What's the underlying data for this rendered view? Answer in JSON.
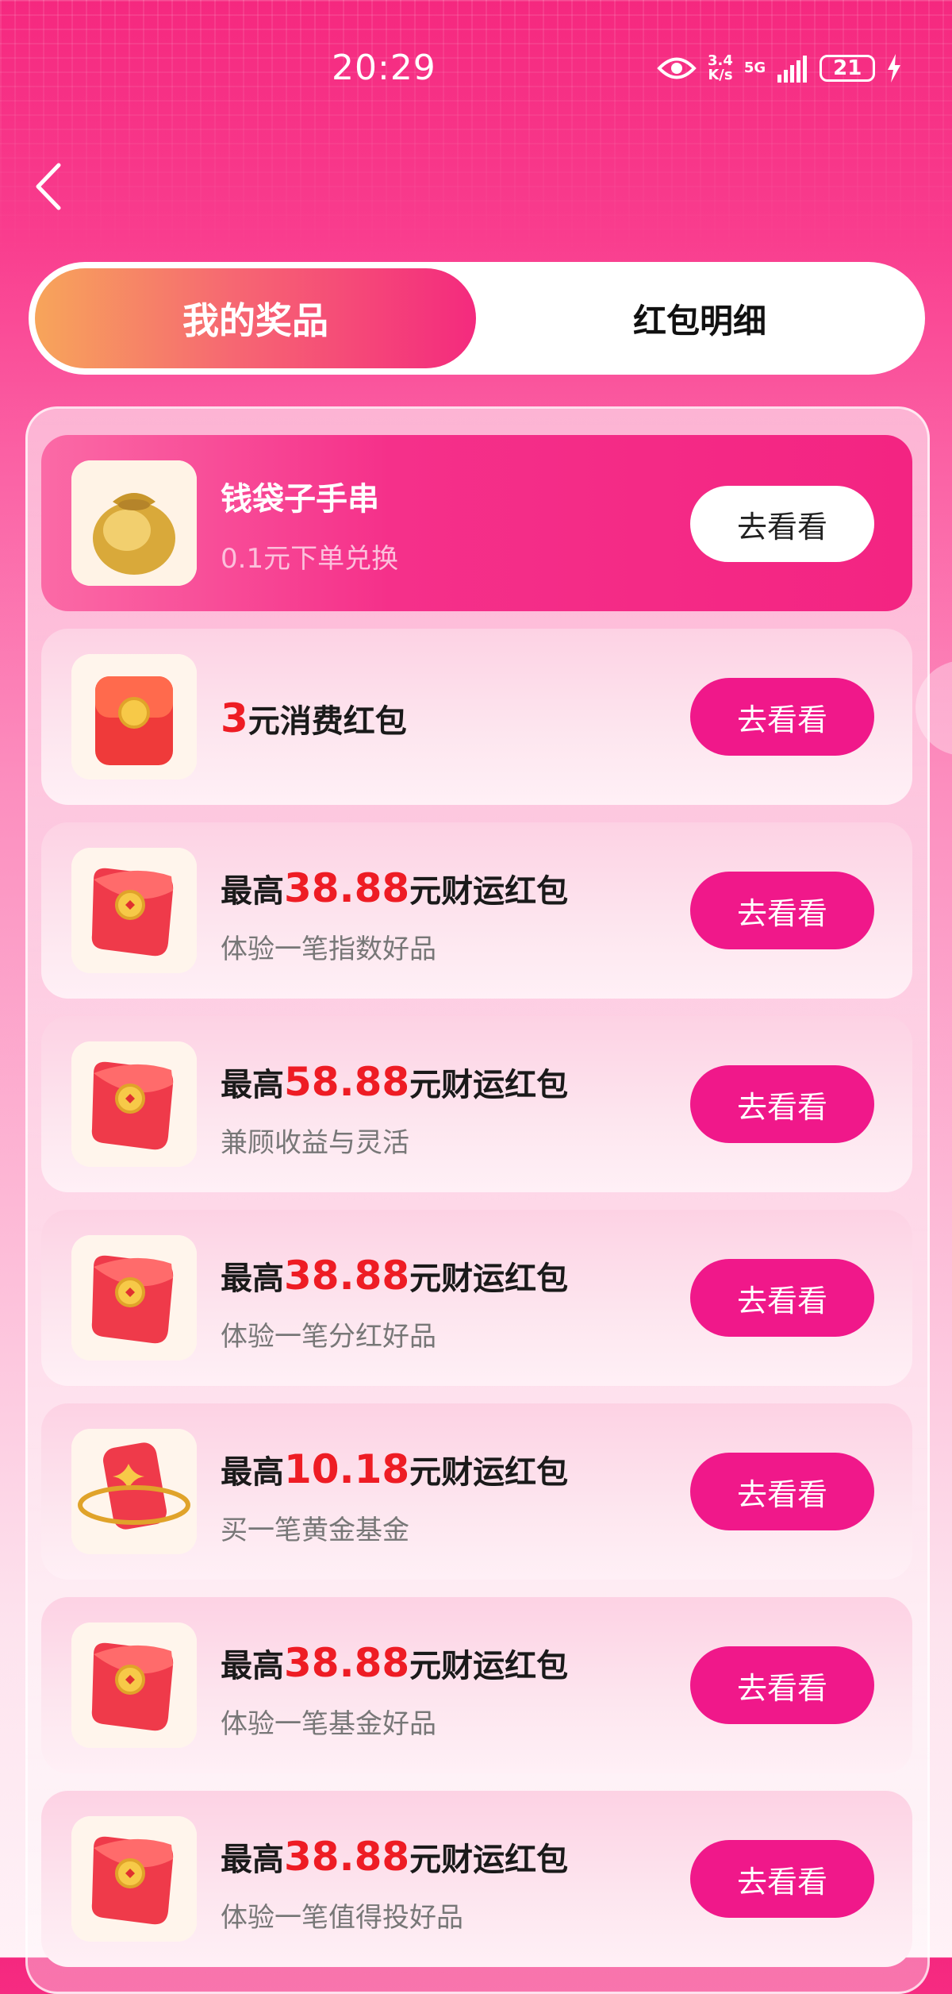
{
  "status_bar": {
    "time": "20:29",
    "net_speed_value": "3.4",
    "net_speed_unit": "K/s",
    "network": "5G",
    "battery": "21"
  },
  "nav": {
    "back_icon": "chevron-left-icon"
  },
  "tabs": [
    {
      "label": "我的奖品",
      "active": true
    },
    {
      "label": "红包明细",
      "active": false
    }
  ],
  "colors": {
    "accent": "#f0188a",
    "amount_red": "#ee1c24",
    "tab_gradient_start": "#f7a55a"
  },
  "prizes": [
    {
      "title": "钱袋子手串",
      "subtitle": "0.1元下单兑换",
      "button": "去看看",
      "icon": "money-bag-bracelet-icon"
    },
    {
      "amount": "3",
      "title_suffix": "元消费红包",
      "button": "去看看",
      "icon": "red-envelope-icon"
    },
    {
      "prefix": "最高",
      "amount": "38.88",
      "suffix": "元财运红包",
      "subtitle": "体验一笔指数好品",
      "button": "去看看",
      "icon": "red-envelope-icon"
    },
    {
      "prefix": "最高",
      "amount": "58.88",
      "suffix": "元财运红包",
      "subtitle": "兼顾收益与灵活",
      "button": "去看看",
      "icon": "red-envelope-icon"
    },
    {
      "prefix": "最高",
      "amount": "38.88",
      "suffix": "元财运红包",
      "subtitle": "体验一笔分红好品",
      "button": "去看看",
      "icon": "red-envelope-icon"
    },
    {
      "prefix": "最高",
      "amount": "10.18",
      "suffix": "元财运红包",
      "subtitle": "买一笔黄金基金",
      "button": "去看看",
      "icon": "gold-ring-envelope-icon"
    },
    {
      "prefix": "最高",
      "amount": "38.88",
      "suffix": "元财运红包",
      "subtitle": "体验一笔基金好品",
      "button": "去看看",
      "icon": "red-envelope-icon"
    },
    {
      "prefix": "最高",
      "amount": "38.88",
      "suffix": "元财运红包",
      "subtitle": "体验一笔值得投好品",
      "button": "去看看",
      "icon": "red-envelope-icon"
    }
  ]
}
